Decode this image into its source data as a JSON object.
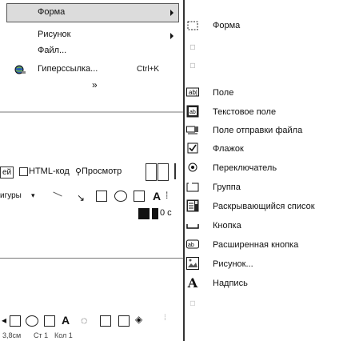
{
  "left_menu": {
    "items": [
      {
        "label": "Форма"
      },
      {
        "label": "Рисунок"
      },
      {
        "label": "Файл..."
      },
      {
        "label": "Гиперссылка...",
        "shortcut": "Ctrl+K"
      }
    ],
    "more_indicator": "»"
  },
  "right_menu": {
    "items": [
      {
        "label": "Форма",
        "icon": "form-dotted-box-icon"
      },
      {
        "label": "Поле",
        "icon": "field-icon"
      },
      {
        "label": "Текстовое поле",
        "icon": "text-area-icon"
      },
      {
        "label": "Поле отправки файла",
        "icon": "file-upload-field-icon"
      },
      {
        "label": "Флажок",
        "icon": "checkbox-icon"
      },
      {
        "label": "Переключатель",
        "icon": "radio-button-icon"
      },
      {
        "label": "Группа",
        "icon": "group-box-icon"
      },
      {
        "label": "Раскрывающийся список",
        "icon": "dropdown-list-icon"
      },
      {
        "label": "Кнопка",
        "icon": "button-icon"
      },
      {
        "label": "Расширенная кнопка",
        "icon": "advanced-button-icon"
      },
      {
        "label": "Рисунок...",
        "icon": "picture-icon"
      },
      {
        "label": "Надпись",
        "icon": "label-a-icon"
      }
    ]
  },
  "editor": {
    "tabs": [
      "ей",
      "HTML-код",
      "Просмотр"
    ],
    "toolbar_label": "игуры",
    "blackbar_text": "0 с",
    "status": {
      "position": "3,8см",
      "line": "Ст 1",
      "col": "Кол 1"
    }
  }
}
